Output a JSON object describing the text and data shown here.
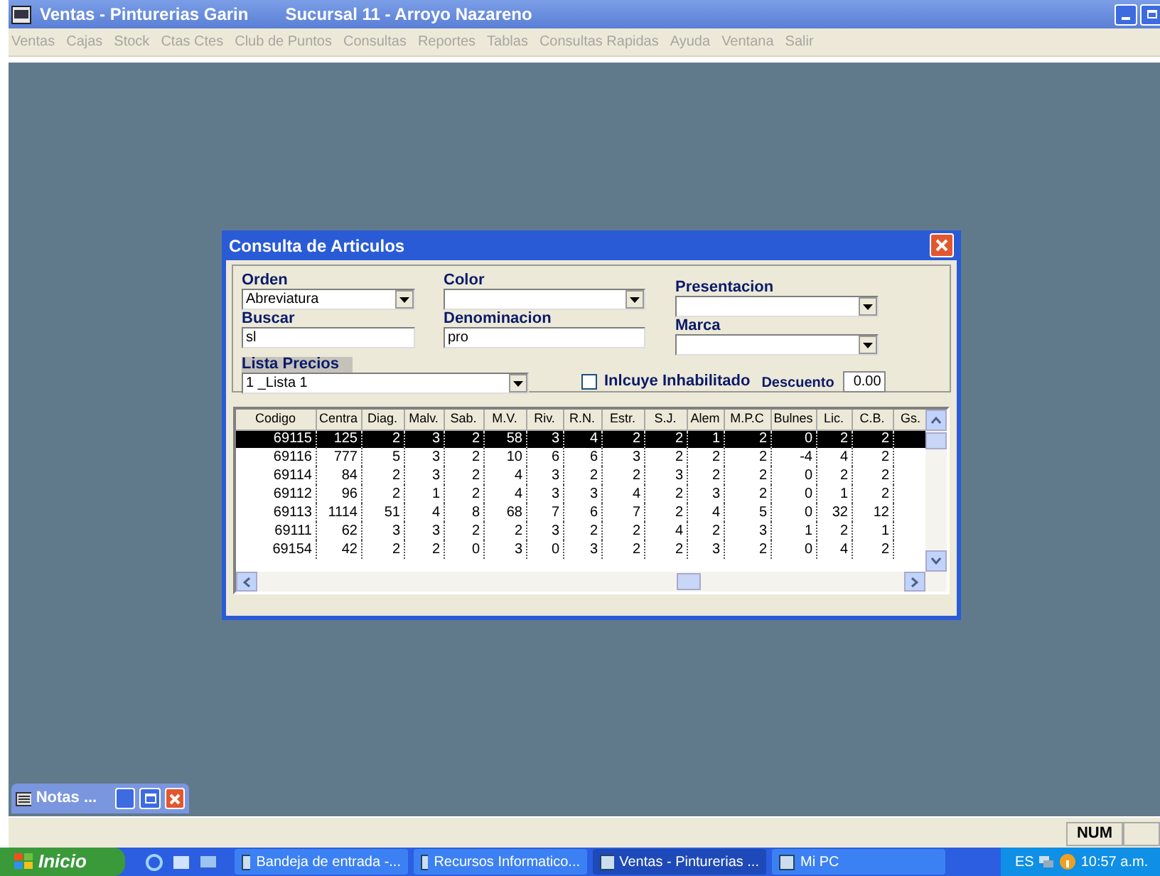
{
  "window": {
    "title": "Ventas - Pinturerias Garin",
    "subtitle": "Sucursal 11 - Arroyo Nazareno"
  },
  "menu": [
    {
      "label": "Ventas",
      "disabled": true
    },
    {
      "label": "Cajas",
      "disabled": true
    },
    {
      "label": "Stock",
      "disabled": true
    },
    {
      "label": "Ctas Ctes",
      "disabled": true
    },
    {
      "label": "Club de Puntos",
      "disabled": true
    },
    {
      "label": "Consultas",
      "disabled": true
    },
    {
      "label": "Reportes",
      "disabled": true
    },
    {
      "label": "Tablas",
      "disabled": true
    },
    {
      "label": "Consultas Rapidas",
      "disabled": true
    },
    {
      "label": "Ayuda",
      "disabled": true
    },
    {
      "label": "Ventana",
      "disabled": true
    },
    {
      "label": "Salir",
      "disabled": true
    }
  ],
  "dialog": {
    "title": "Consulta de Articulos",
    "orden": {
      "kind": "combo",
      "label": "Orden",
      "value": "Abreviatura"
    },
    "buscar": {
      "kind": "text",
      "label": "Buscar",
      "value": "sl"
    },
    "color": {
      "kind": "combo",
      "label": "Color"
    },
    "denominacion": {
      "kind": "text",
      "label": "Denominacion",
      "value": "pro"
    },
    "presentacion": {
      "kind": "combo",
      "label": "Presentacion"
    },
    "marca": {
      "kind": "combo",
      "label": "Marca"
    },
    "lista_precios": {
      "kind": "combo",
      "label": "Lista Precios",
      "value": "1 _Lista 1"
    },
    "incluye_inhabilitado": {
      "label": "Inlcuye Inhabilitado",
      "checked": false
    },
    "descuento": {
      "label": "Descuento",
      "value": "0.00"
    },
    "table": {
      "columns": [
        "Codigo",
        "Centra",
        "Diag.",
        "Malv.",
        "Sab.",
        "M.V.",
        "Riv.",
        "R.N.",
        "Estr.",
        "S.J.",
        "Alem",
        "M.P.C",
        "Bulnes",
        "Lic.",
        "C.B.",
        "Gs."
      ],
      "rows": [
        {
          "selected": true,
          "cells": [
            "69115",
            "125",
            "2",
            "3",
            "2",
            "58",
            "3",
            "4",
            "2",
            "2",
            "1",
            "2",
            "0",
            "2",
            "2"
          ]
        },
        {
          "selected": false,
          "cells": [
            "69116",
            "777",
            "5",
            "3",
            "2",
            "10",
            "6",
            "6",
            "3",
            "2",
            "2",
            "2",
            "-4",
            "4",
            "2"
          ]
        },
        {
          "selected": false,
          "cells": [
            "69114",
            "84",
            "2",
            "3",
            "2",
            "4",
            "3",
            "2",
            "2",
            "3",
            "2",
            "2",
            "0",
            "2",
            "2"
          ]
        },
        {
          "selected": false,
          "cells": [
            "69112",
            "96",
            "2",
            "1",
            "2",
            "4",
            "3",
            "3",
            "4",
            "2",
            "3",
            "2",
            "0",
            "1",
            "2"
          ]
        },
        {
          "selected": false,
          "cells": [
            "69113",
            "1114",
            "51",
            "4",
            "8",
            "68",
            "7",
            "6",
            "7",
            "2",
            "4",
            "5",
            "0",
            "32",
            "12"
          ]
        },
        {
          "selected": false,
          "cells": [
            "69111",
            "62",
            "3",
            "3",
            "2",
            "2",
            "3",
            "2",
            "2",
            "4",
            "2",
            "3",
            "1",
            "2",
            "1"
          ]
        },
        {
          "selected": false,
          "cells": [
            "69154",
            "42",
            "2",
            "2",
            "0",
            "3",
            "0",
            "3",
            "2",
            "2",
            "3",
            "2",
            "0",
            "4",
            "2"
          ]
        }
      ]
    }
  },
  "minimized_window": {
    "title": "Notas ..."
  },
  "status_bar": {
    "panels": [
      "NUM"
    ]
  },
  "taskbar": {
    "start": "Inicio",
    "tasks": [
      {
        "label": "Bandeja de entrada -...",
        "selected": false
      },
      {
        "label": "Recursos Informatico...",
        "selected": false
      },
      {
        "label": "Ventas - Pinturerias ...",
        "selected": true
      },
      {
        "label": "Mi PC",
        "selected": false
      }
    ],
    "language": "ES",
    "clock": "10:57 a.m."
  }
}
